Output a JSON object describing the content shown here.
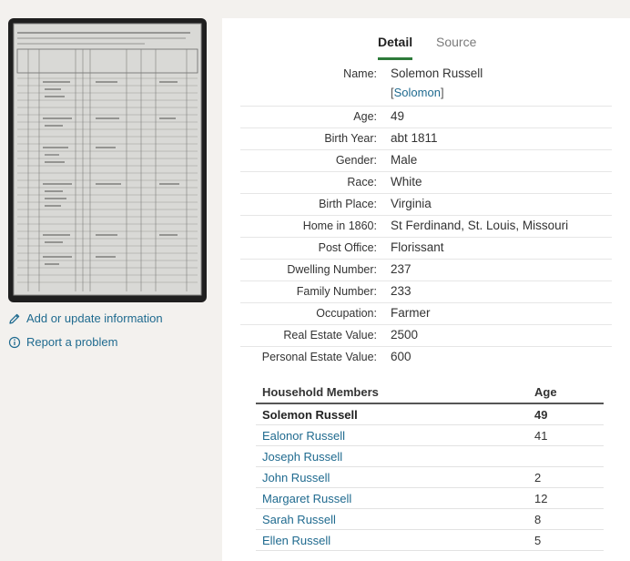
{
  "tabs": [
    {
      "label": "Detail",
      "active": true
    },
    {
      "label": "Source",
      "active": false
    }
  ],
  "sidebar": {
    "links": [
      {
        "label": "Add or update information",
        "icon": "pencil-icon"
      },
      {
        "label": "Report a problem",
        "icon": "info-circle-icon"
      }
    ]
  },
  "record": {
    "name": {
      "label": "Name:",
      "value": "Solemon Russell",
      "alias_open": "[",
      "alias": "Solomon",
      "alias_close": "]"
    },
    "fields": [
      {
        "label": "Age:",
        "value": "49"
      },
      {
        "label": "Birth Year:",
        "value": "abt 1811"
      },
      {
        "label": "Gender:",
        "value": "Male"
      },
      {
        "label": "Race:",
        "value": "White"
      },
      {
        "label": "Birth Place:",
        "value": "Virginia"
      },
      {
        "label": "Home in 1860:",
        "value": "St Ferdinand, St. Louis, Missouri"
      },
      {
        "label": "Post Office:",
        "value": "Florissant"
      },
      {
        "label": "Dwelling Number:",
        "value": "237"
      },
      {
        "label": "Family Number:",
        "value": "233"
      },
      {
        "label": "Occupation:",
        "value": "Farmer"
      },
      {
        "label": "Real Estate Value:",
        "value": "2500"
      },
      {
        "label": "Personal Estate Value:",
        "value": "600"
      }
    ]
  },
  "household": {
    "header_name": "Household Members",
    "header_age": "Age",
    "members": [
      {
        "name": "Solemon Russell",
        "age": "49",
        "self": true
      },
      {
        "name": "Ealonor Russell",
        "age": "41"
      },
      {
        "name": "Joseph Russell",
        "age": ""
      },
      {
        "name": "John Russell",
        "age": "2"
      },
      {
        "name": "Margaret Russell",
        "age": "12"
      },
      {
        "name": "Sarah Russell",
        "age": "8"
      },
      {
        "name": "Ellen Russell",
        "age": "5"
      }
    ]
  },
  "colors": {
    "link": "#1f6a8f",
    "active_tab_underline": "#2d7a3a",
    "page_background": "#f3f1ee"
  }
}
